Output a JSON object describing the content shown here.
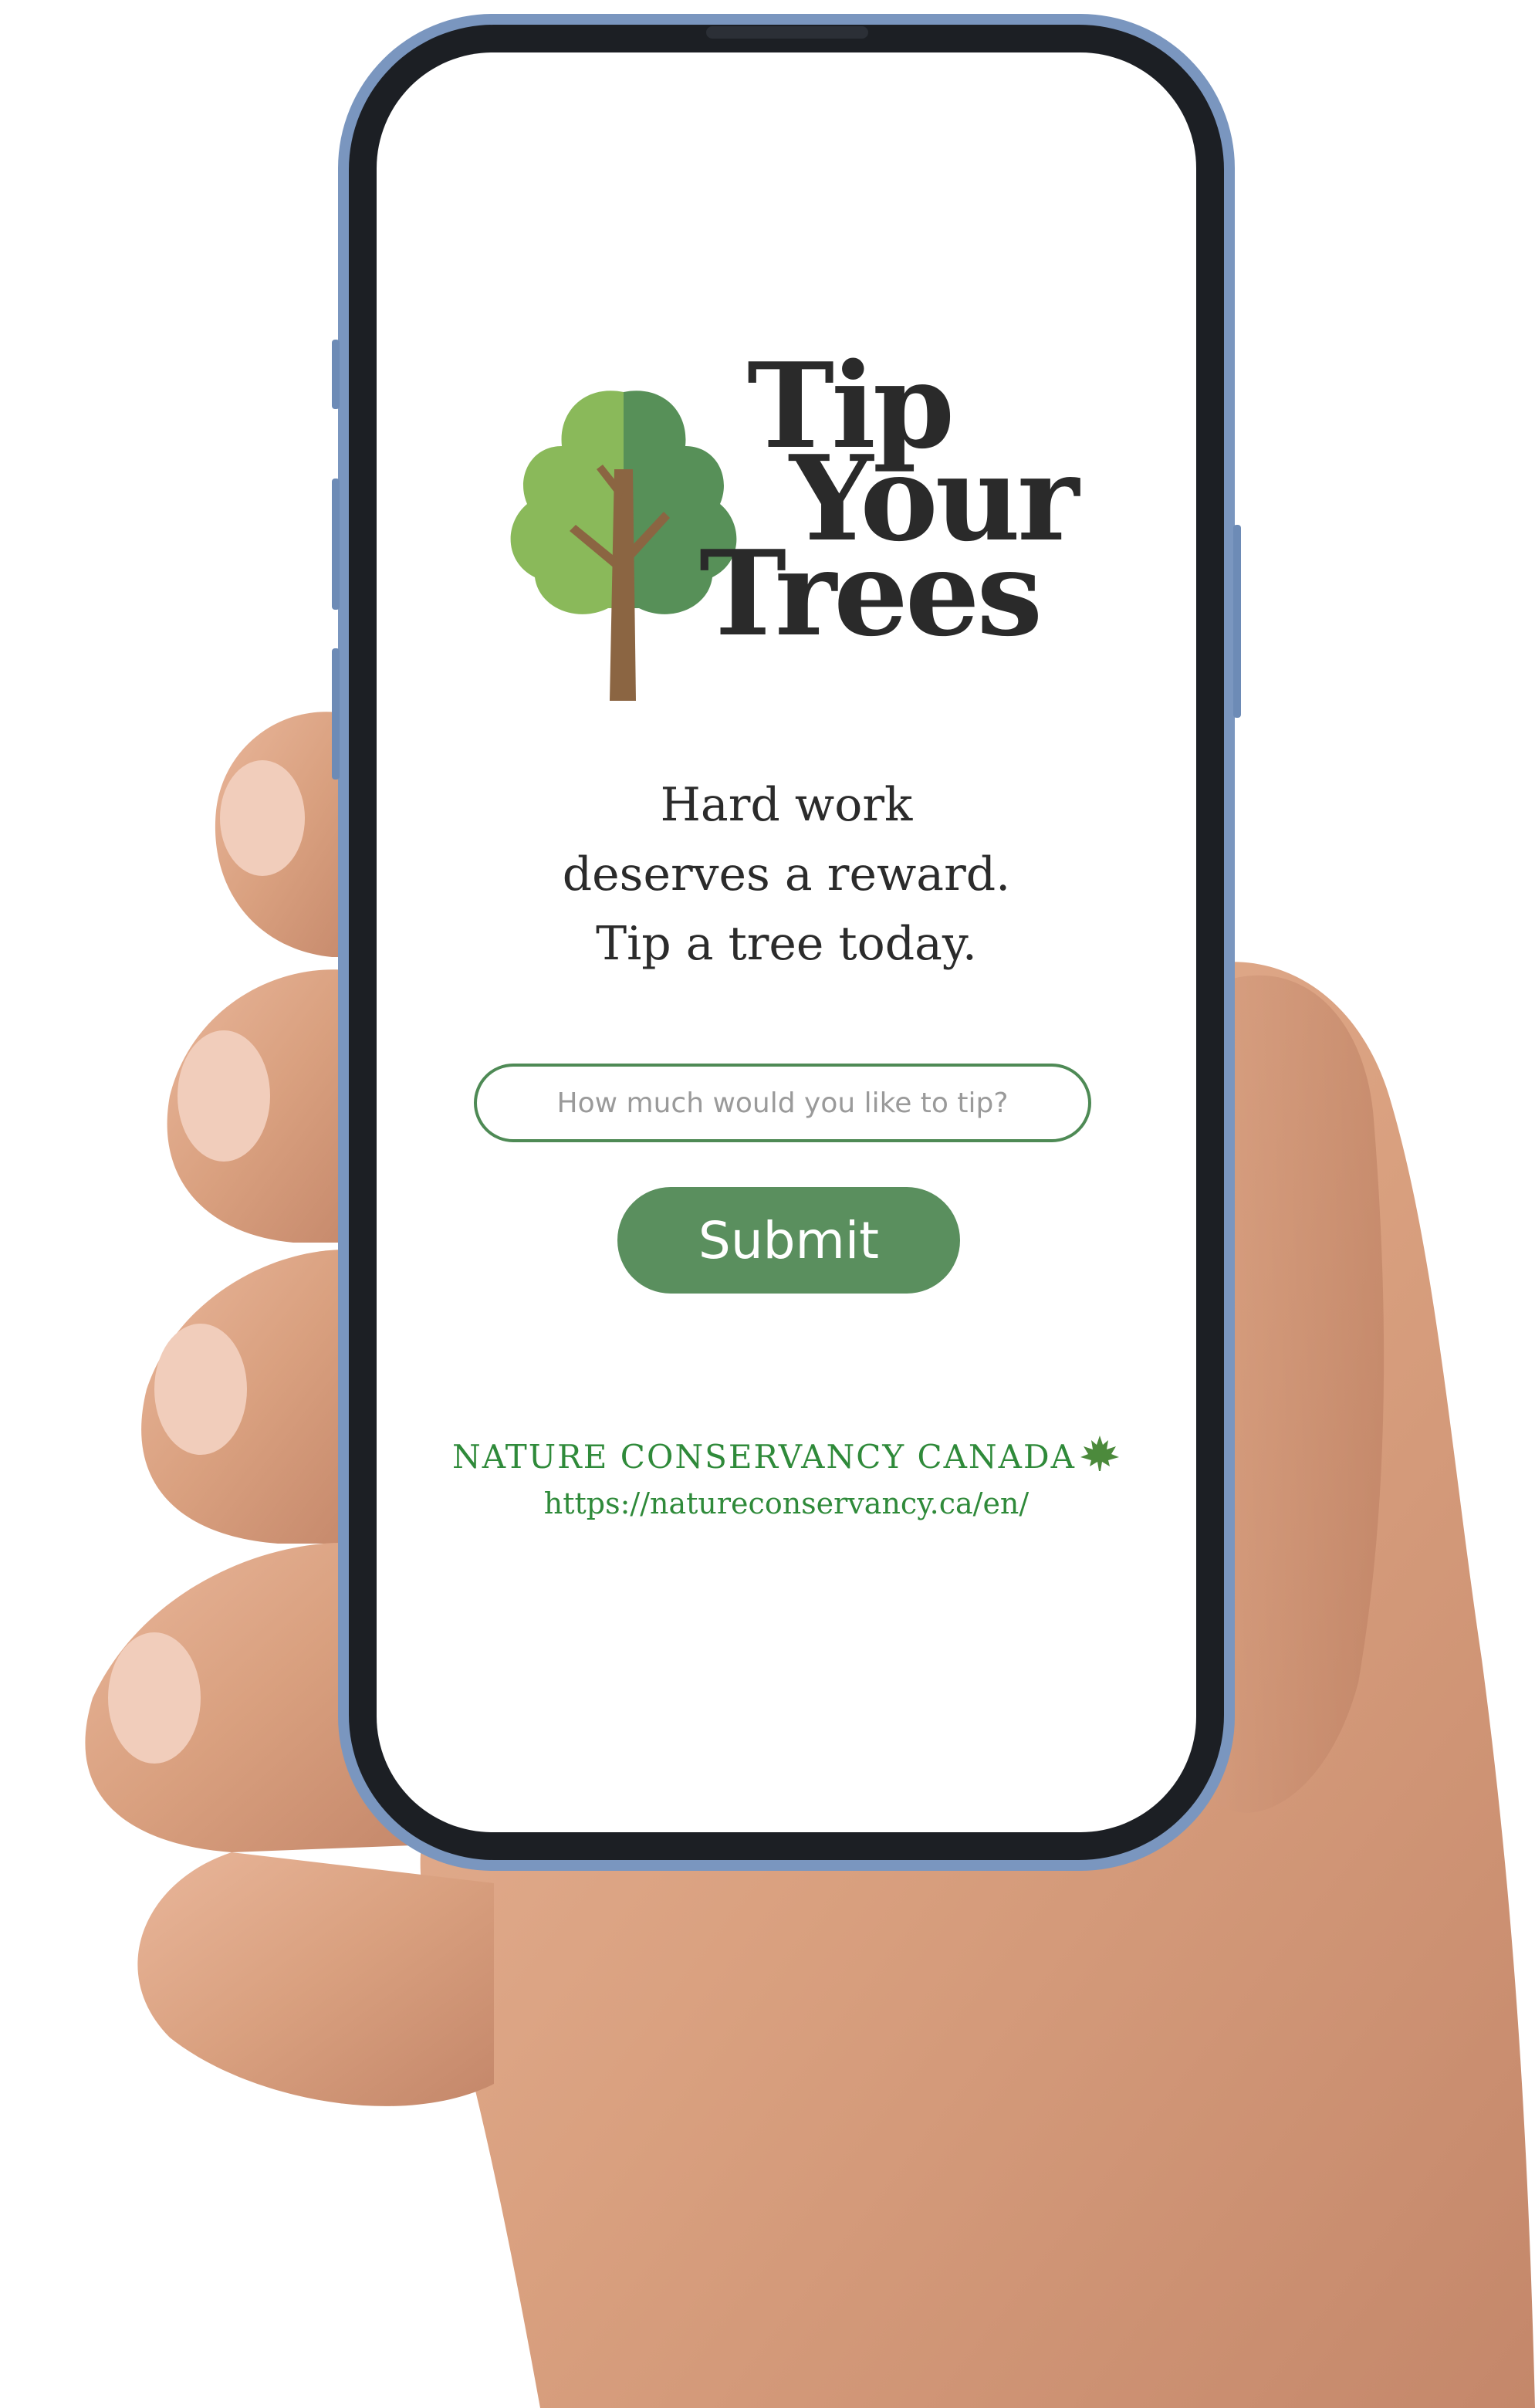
{
  "logo": {
    "word1": "Tip",
    "word2": "Your",
    "word3": "Trees"
  },
  "tagline": {
    "line1": "Hard work",
    "line2": "deserves a reward.",
    "line3": "Tip a tree today."
  },
  "tip_form": {
    "placeholder": "How much would you like to tip?",
    "value": "",
    "submit_label": "Submit"
  },
  "footer": {
    "org_name": "NATURE CONSERVANCY CANADA",
    "url": "https://natureconservancy.ca/en/",
    "org_icon": "maple-leaf-icon"
  },
  "colors": {
    "brand_green": "#5a8f5e",
    "input_border": "#4e8a55",
    "org_green": "#2f8a3a",
    "tree_light": "#8ab95a",
    "tree_dark": "#579058",
    "trunk": "#8b6542",
    "phone_frame": "#1c1f24",
    "phone_edge": "#6d8bb6"
  }
}
